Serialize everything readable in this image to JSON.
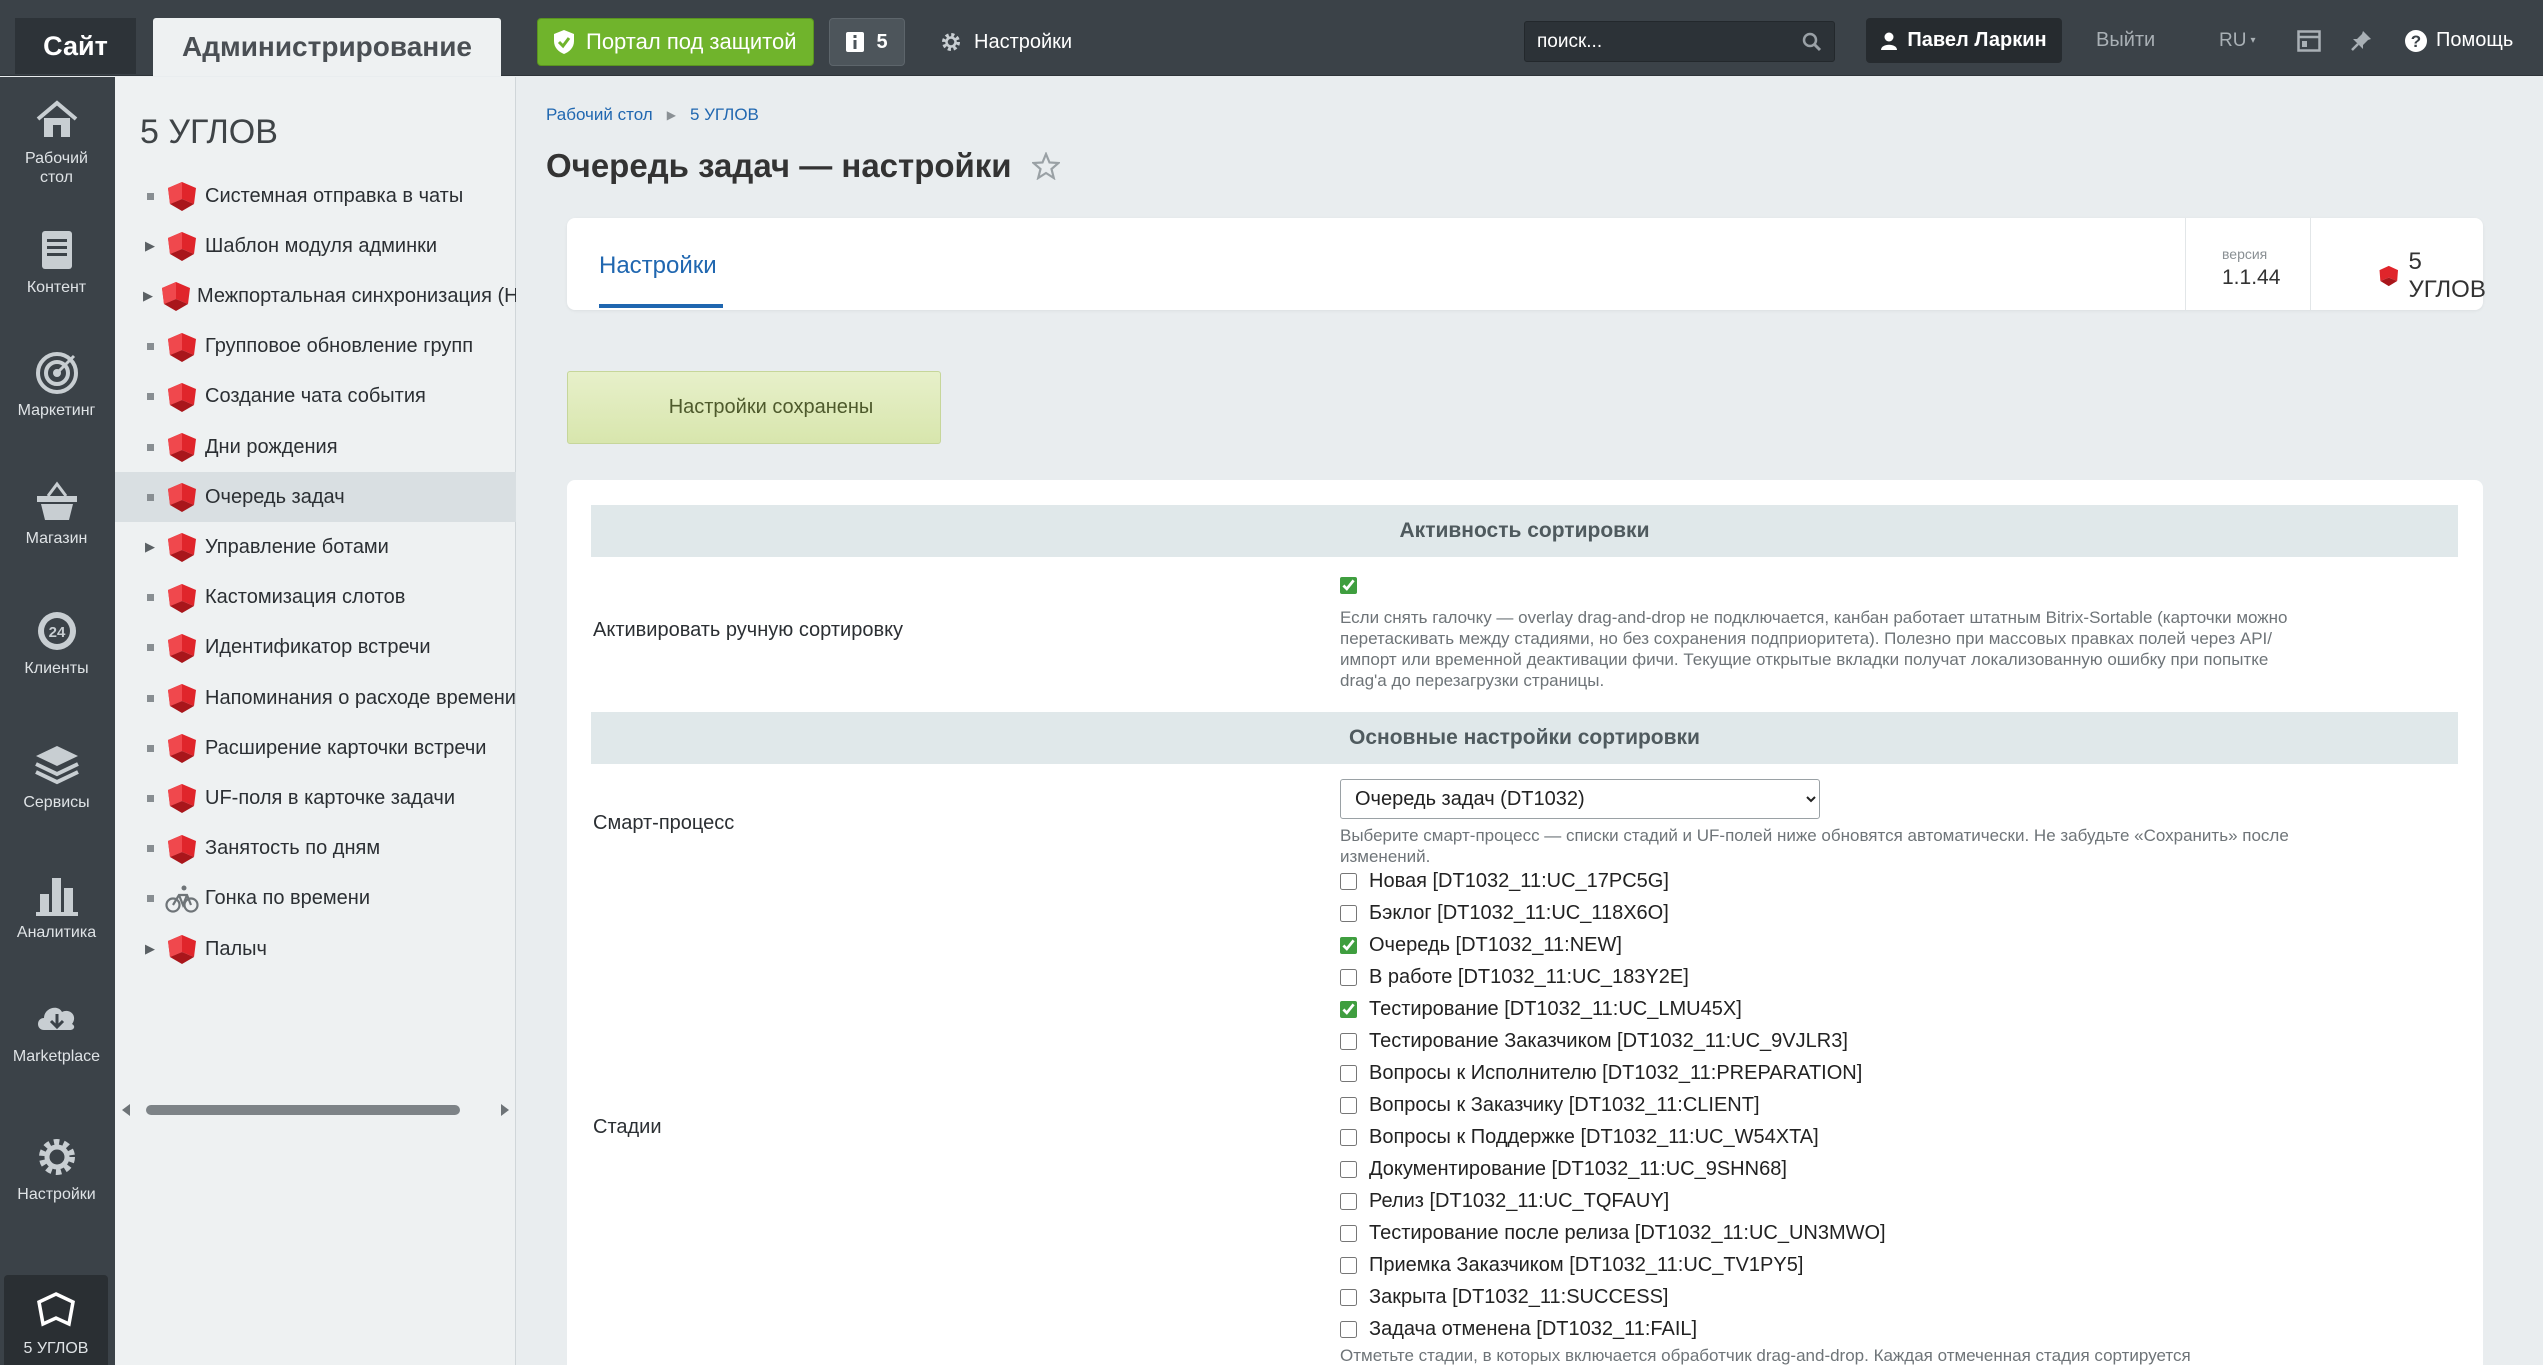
{
  "topbar": {
    "site_tab": "Сайт",
    "admin_tab": "Администрирование",
    "portal_button": "Портал под защитой",
    "notifications_count": "5",
    "settings_link": "Настройки",
    "search_placeholder": "поиск...",
    "user_name": "Павел Ларкин",
    "logout": "Выйти",
    "lang": "RU",
    "help": "Помощь"
  },
  "leftbar": {
    "items": [
      {
        "label": "Рабочий стол",
        "icon": "house-icon"
      },
      {
        "label": "Контент",
        "icon": "document-icon"
      },
      {
        "label": "Маркетинг",
        "icon": "target-icon"
      },
      {
        "label": "Магазин",
        "icon": "basket-icon"
      },
      {
        "label": "Клиенты",
        "icon": "crm-24-icon"
      },
      {
        "label": "Сервисы",
        "icon": "layers-icon"
      },
      {
        "label": "Аналитика",
        "icon": "bar-chart-icon"
      },
      {
        "label": "Marketplace",
        "icon": "cloud-download-icon"
      },
      {
        "label": "Настройки",
        "icon": "gear-icon"
      },
      {
        "label": "5 УГЛОВ",
        "icon": "five-corners-icon"
      }
    ]
  },
  "menu": {
    "title": "5 УГЛОВ",
    "items": [
      {
        "label": "Системная отправка в чаты",
        "expandable": false
      },
      {
        "label": "Шаблон модуля админки",
        "expandable": true
      },
      {
        "label": "Межпортальная синхронизация (Н",
        "expandable": true
      },
      {
        "label": "Групповое обновление групп",
        "expandable": false
      },
      {
        "label": "Создание чата события",
        "expandable": false
      },
      {
        "label": "Дни рождения",
        "expandable": false
      },
      {
        "label": "Очередь задач",
        "expandable": false,
        "selected": true
      },
      {
        "label": "Управление ботами",
        "expandable": true
      },
      {
        "label": "Кастомизация слотов",
        "expandable": false
      },
      {
        "label": "Идентификатор встречи",
        "expandable": false
      },
      {
        "label": "Напоминания о расходе времени",
        "expandable": false
      },
      {
        "label": "Расширение карточки встречи",
        "expandable": false
      },
      {
        "label": "UF-поля в карточке задачи",
        "expandable": false
      },
      {
        "label": "Занятость по дням",
        "expandable": false
      },
      {
        "label": "Гонка по времени",
        "expandable": false,
        "icon": "bicycle-icon"
      },
      {
        "label": "Палыч",
        "expandable": true
      }
    ]
  },
  "breadcrumb": {
    "home": "Рабочий стол",
    "current": "5 УГЛОВ"
  },
  "page": {
    "title": "Очередь задач — настройки",
    "tab": "Настройки",
    "version_label": "версия",
    "version": "1.1.44",
    "brand": "5 УГЛОВ",
    "saved_message": "Настройки сохранены"
  },
  "form": {
    "section1": "Активность сортировки",
    "activate_label": "Активировать ручную сортировку",
    "activate_checked": true,
    "activate_hint": "Если снять галочку — overlay drag-and-drop не подключается, канбан работает штатным Bitrix-Sortable (карточки можно перетаскивать между стадиями, но без сохранения подприоритета). Полезно при массовых правках полей через API/импорт или временной деактивации фичи. Текущие открытые вкладки получат локализованную ошибку при попытке drag'a до перезагрузки страницы.",
    "section2": "Основные настройки сортировки",
    "smart_label": "Смарт-процесс",
    "smart_value": "Очередь задач (DT1032)",
    "smart_hint": "Выберите смарт-процесс — списки стадий и UF-полей ниже обновятся автоматически. Не забудьте «Сохранить» после изменений.",
    "stages_label": "Стадии",
    "stages": [
      {
        "label": "Новая [DT1032_11:UC_17PC5G]",
        "checked": false
      },
      {
        "label": "Бэклог [DT1032_11:UC_118X6O]",
        "checked": false
      },
      {
        "label": "Очередь [DT1032_11:NEW]",
        "checked": true
      },
      {
        "label": "В работе [DT1032_11:UC_183Y2E]",
        "checked": false
      },
      {
        "label": "Тестирование [DT1032_11:UC_LMU45X]",
        "checked": true
      },
      {
        "label": "Тестирование Заказчиком [DT1032_11:UC_9VJLR3]",
        "checked": false
      },
      {
        "label": "Вопросы к Исполнителю [DT1032_11:PREPARATION]",
        "checked": false
      },
      {
        "label": "Вопросы к Заказчику [DT1032_11:CLIENT]",
        "checked": false
      },
      {
        "label": "Вопросы к Поддержке [DT1032_11:UC_W54XTA]",
        "checked": false
      },
      {
        "label": "Документирование [DT1032_11:UC_9SHN68]",
        "checked": false
      },
      {
        "label": "Релиз [DT1032_11:UC_TQFAUY]",
        "checked": false
      },
      {
        "label": "Тестирование после релиза [DT1032_11:UC_UN3MWO]",
        "checked": false
      },
      {
        "label": "Приемка Заказчиком [DT1032_11:UC_TV1PY5]",
        "checked": false
      },
      {
        "label": "Закрыта [DT1032_11:SUCCESS]",
        "checked": false
      },
      {
        "label": "Задача отменена [DT1032_11:FAIL]",
        "checked": false
      }
    ],
    "stages_hint": "Отметьте стадии, в которых включается обработчик drag-and-drop. Каждая отмеченная стадия сортируется"
  },
  "colors": {
    "accent": "#2067b0",
    "brand_red": "#e0252b",
    "green": "#70b42c"
  }
}
